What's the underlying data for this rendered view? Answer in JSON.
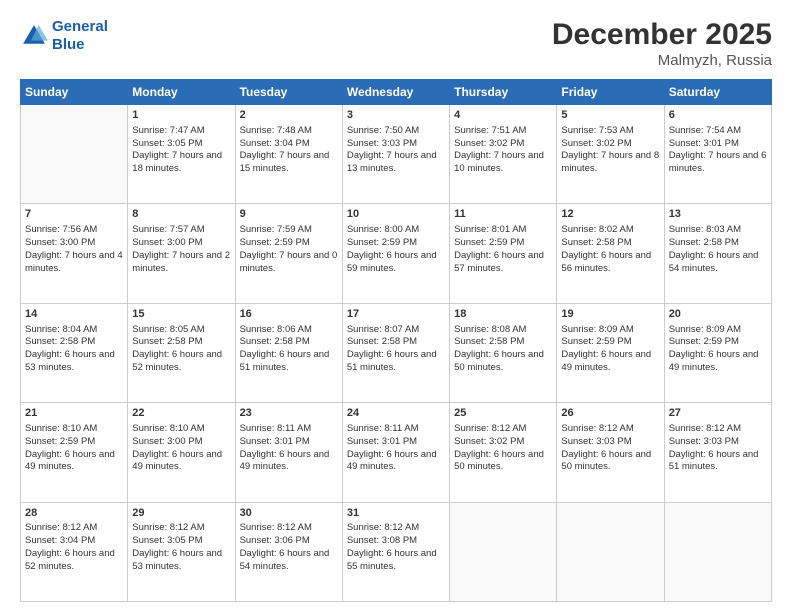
{
  "header": {
    "logo_line1": "General",
    "logo_line2": "Blue",
    "month_year": "December 2025",
    "location": "Malmyzh, Russia"
  },
  "days_of_week": [
    "Sunday",
    "Monday",
    "Tuesday",
    "Wednesday",
    "Thursday",
    "Friday",
    "Saturday"
  ],
  "weeks": [
    [
      {
        "day": "",
        "empty": true
      },
      {
        "day": "1",
        "sunrise": "Sunrise: 7:47 AM",
        "sunset": "Sunset: 3:05 PM",
        "daylight": "Daylight: 7 hours and 18 minutes."
      },
      {
        "day": "2",
        "sunrise": "Sunrise: 7:48 AM",
        "sunset": "Sunset: 3:04 PM",
        "daylight": "Daylight: 7 hours and 15 minutes."
      },
      {
        "day": "3",
        "sunrise": "Sunrise: 7:50 AM",
        "sunset": "Sunset: 3:03 PM",
        "daylight": "Daylight: 7 hours and 13 minutes."
      },
      {
        "day": "4",
        "sunrise": "Sunrise: 7:51 AM",
        "sunset": "Sunset: 3:02 PM",
        "daylight": "Daylight: 7 hours and 10 minutes."
      },
      {
        "day": "5",
        "sunrise": "Sunrise: 7:53 AM",
        "sunset": "Sunset: 3:02 PM",
        "daylight": "Daylight: 7 hours and 8 minutes."
      },
      {
        "day": "6",
        "sunrise": "Sunrise: 7:54 AM",
        "sunset": "Sunset: 3:01 PM",
        "daylight": "Daylight: 7 hours and 6 minutes."
      }
    ],
    [
      {
        "day": "7",
        "sunrise": "Sunrise: 7:56 AM",
        "sunset": "Sunset: 3:00 PM",
        "daylight": "Daylight: 7 hours and 4 minutes."
      },
      {
        "day": "8",
        "sunrise": "Sunrise: 7:57 AM",
        "sunset": "Sunset: 3:00 PM",
        "daylight": "Daylight: 7 hours and 2 minutes."
      },
      {
        "day": "9",
        "sunrise": "Sunrise: 7:59 AM",
        "sunset": "Sunset: 2:59 PM",
        "daylight": "Daylight: 7 hours and 0 minutes."
      },
      {
        "day": "10",
        "sunrise": "Sunrise: 8:00 AM",
        "sunset": "Sunset: 2:59 PM",
        "daylight": "Daylight: 6 hours and 59 minutes."
      },
      {
        "day": "11",
        "sunrise": "Sunrise: 8:01 AM",
        "sunset": "Sunset: 2:59 PM",
        "daylight": "Daylight: 6 hours and 57 minutes."
      },
      {
        "day": "12",
        "sunrise": "Sunrise: 8:02 AM",
        "sunset": "Sunset: 2:58 PM",
        "daylight": "Daylight: 6 hours and 56 minutes."
      },
      {
        "day": "13",
        "sunrise": "Sunrise: 8:03 AM",
        "sunset": "Sunset: 2:58 PM",
        "daylight": "Daylight: 6 hours and 54 minutes."
      }
    ],
    [
      {
        "day": "14",
        "sunrise": "Sunrise: 8:04 AM",
        "sunset": "Sunset: 2:58 PM",
        "daylight": "Daylight: 6 hours and 53 minutes."
      },
      {
        "day": "15",
        "sunrise": "Sunrise: 8:05 AM",
        "sunset": "Sunset: 2:58 PM",
        "daylight": "Daylight: 6 hours and 52 minutes."
      },
      {
        "day": "16",
        "sunrise": "Sunrise: 8:06 AM",
        "sunset": "Sunset: 2:58 PM",
        "daylight": "Daylight: 6 hours and 51 minutes."
      },
      {
        "day": "17",
        "sunrise": "Sunrise: 8:07 AM",
        "sunset": "Sunset: 2:58 PM",
        "daylight": "Daylight: 6 hours and 51 minutes."
      },
      {
        "day": "18",
        "sunrise": "Sunrise: 8:08 AM",
        "sunset": "Sunset: 2:58 PM",
        "daylight": "Daylight: 6 hours and 50 minutes."
      },
      {
        "day": "19",
        "sunrise": "Sunrise: 8:09 AM",
        "sunset": "Sunset: 2:59 PM",
        "daylight": "Daylight: 6 hours and 49 minutes."
      },
      {
        "day": "20",
        "sunrise": "Sunrise: 8:09 AM",
        "sunset": "Sunset: 2:59 PM",
        "daylight": "Daylight: 6 hours and 49 minutes."
      }
    ],
    [
      {
        "day": "21",
        "sunrise": "Sunrise: 8:10 AM",
        "sunset": "Sunset: 2:59 PM",
        "daylight": "Daylight: 6 hours and 49 minutes."
      },
      {
        "day": "22",
        "sunrise": "Sunrise: 8:10 AM",
        "sunset": "Sunset: 3:00 PM",
        "daylight": "Daylight: 6 hours and 49 minutes."
      },
      {
        "day": "23",
        "sunrise": "Sunrise: 8:11 AM",
        "sunset": "Sunset: 3:01 PM",
        "daylight": "Daylight: 6 hours and 49 minutes."
      },
      {
        "day": "24",
        "sunrise": "Sunrise: 8:11 AM",
        "sunset": "Sunset: 3:01 PM",
        "daylight": "Daylight: 6 hours and 49 minutes."
      },
      {
        "day": "25",
        "sunrise": "Sunrise: 8:12 AM",
        "sunset": "Sunset: 3:02 PM",
        "daylight": "Daylight: 6 hours and 50 minutes."
      },
      {
        "day": "26",
        "sunrise": "Sunrise: 8:12 AM",
        "sunset": "Sunset: 3:03 PM",
        "daylight": "Daylight: 6 hours and 50 minutes."
      },
      {
        "day": "27",
        "sunrise": "Sunrise: 8:12 AM",
        "sunset": "Sunset: 3:03 PM",
        "daylight": "Daylight: 6 hours and 51 minutes."
      }
    ],
    [
      {
        "day": "28",
        "sunrise": "Sunrise: 8:12 AM",
        "sunset": "Sunset: 3:04 PM",
        "daylight": "Daylight: 6 hours and 52 minutes."
      },
      {
        "day": "29",
        "sunrise": "Sunrise: 8:12 AM",
        "sunset": "Sunset: 3:05 PM",
        "daylight": "Daylight: 6 hours and 53 minutes."
      },
      {
        "day": "30",
        "sunrise": "Sunrise: 8:12 AM",
        "sunset": "Sunset: 3:06 PM",
        "daylight": "Daylight: 6 hours and 54 minutes."
      },
      {
        "day": "31",
        "sunrise": "Sunrise: 8:12 AM",
        "sunset": "Sunset: 3:08 PM",
        "daylight": "Daylight: 6 hours and 55 minutes."
      },
      {
        "day": "",
        "empty": true
      },
      {
        "day": "",
        "empty": true
      },
      {
        "day": "",
        "empty": true
      }
    ]
  ]
}
